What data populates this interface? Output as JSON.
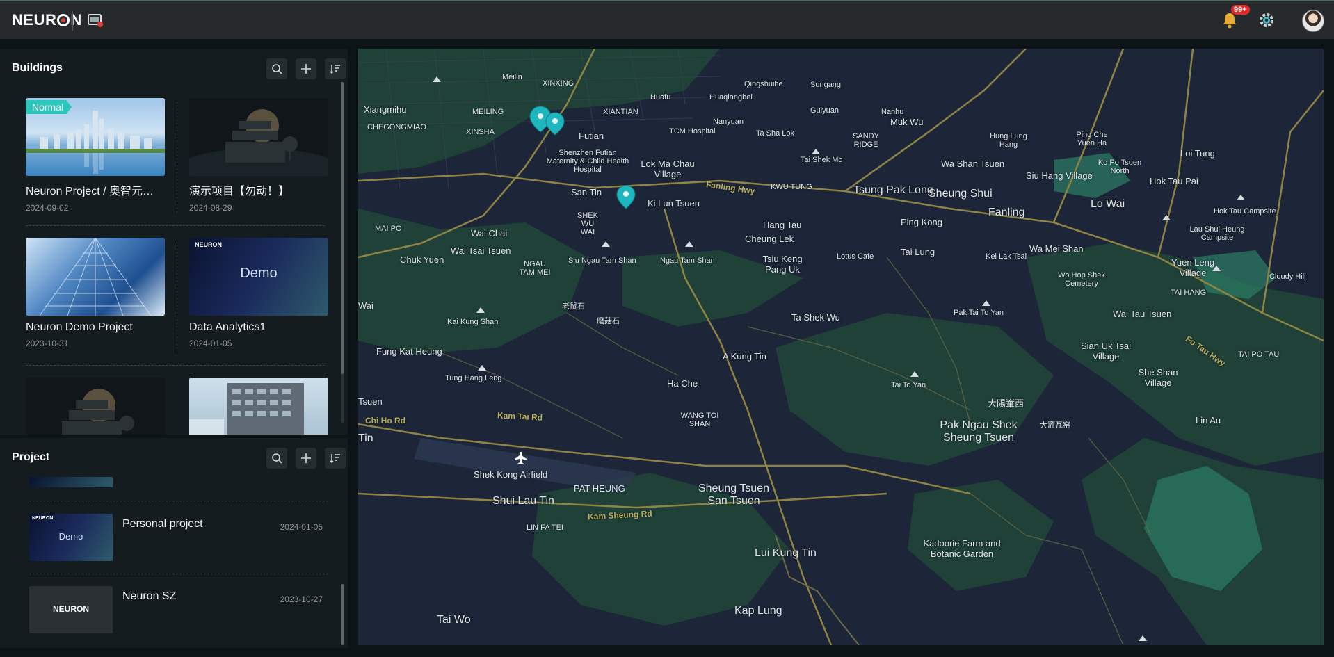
{
  "topbar": {
    "logo": "NEUR",
    "logo_end": "N",
    "notification_badge": "99+"
  },
  "buildings": {
    "title": "Buildings",
    "cards": [
      {
        "name": "Neuron Project / 奥智元…",
        "date": "2024-09-02",
        "tag": "Normal",
        "thumb": "city-skyline"
      },
      {
        "name": "演示项目【勿动！】",
        "date": "2024-08-29",
        "thumb": "placeholder-building"
      },
      {
        "name": "Neuron Demo Project",
        "date": "2023-10-31",
        "thumb": "glass-tower"
      },
      {
        "name": "Data Analytics1",
        "date": "2024-01-05",
        "thumb": "demo-banner",
        "demo_text": "Demo",
        "brand_text": "NEURON"
      },
      {
        "name": "",
        "date": "",
        "thumb": "placeholder-building"
      },
      {
        "name": "",
        "date": "",
        "thumb": "office-building"
      }
    ]
  },
  "project": {
    "title": "Project",
    "rows": [
      {
        "name": "Personal project",
        "date": "2024-01-05",
        "thumb": "demo-banner",
        "demo_text": "Demo",
        "brand_text": "NEURON"
      },
      {
        "name": "Neuron SZ",
        "date": "2023-10-27",
        "thumb": "neuron-logo",
        "brand_text": "NEURON"
      }
    ]
  },
  "map": {
    "labels": [
      {
        "text": "Xiangmihu",
        "type": "md"
      },
      {
        "text": "Meilin",
        "type": "sm"
      },
      {
        "text": "XINXING",
        "type": "sm"
      },
      {
        "text": "Futian",
        "type": "md"
      },
      {
        "text": "TCM Hospital",
        "type": "sm"
      },
      {
        "text": "Huafu",
        "type": "sm"
      },
      {
        "text": "Qingshuihe",
        "type": "sm"
      },
      {
        "text": "Sungang",
        "type": "sm"
      },
      {
        "text": "Guiyuan",
        "type": "sm"
      },
      {
        "text": "Nanhu",
        "type": "sm"
      },
      {
        "text": "Huaqiangbei",
        "type": "sm"
      },
      {
        "text": "Nanyuan",
        "type": "sm"
      },
      {
        "text": "Ta Sha Lok",
        "type": "sm"
      },
      {
        "text": "MEILING",
        "type": "sm"
      },
      {
        "text": "XINSHA",
        "type": "sm"
      },
      {
        "text": "XIANTIAN",
        "type": "sm"
      },
      {
        "text": "CHEGONGMIAO",
        "type": "sm"
      },
      {
        "text": "Shenzhen Futian Maternity & Child Health Hospital",
        "type": "sm"
      },
      {
        "text": "Lok Ma Chau Village",
        "type": "md"
      },
      {
        "text": "San Tin",
        "type": "md"
      },
      {
        "text": "Ki Lun Tsuen",
        "type": "md"
      },
      {
        "text": "Tai Shek Mo",
        "type": "sm"
      },
      {
        "text": "SANDY RIDGE",
        "type": "sm"
      },
      {
        "text": "Muk Wu",
        "type": "md"
      },
      {
        "text": "Hung Lung Hang",
        "type": "sm"
      },
      {
        "text": "Ping Che Yuen Ha",
        "type": "sm"
      },
      {
        "text": "Wa Shan Tsuen",
        "type": "md"
      },
      {
        "text": "Ko Po Tsuen North",
        "type": "sm"
      },
      {
        "text": "Loi Tung",
        "type": "md"
      },
      {
        "text": "Tsung Pak Long",
        "type": "lg"
      },
      {
        "text": "Sheung Shui",
        "type": "lg"
      },
      {
        "text": "Siu Hang Village",
        "type": "md"
      },
      {
        "text": "Hok Tau Pai",
        "type": "md"
      },
      {
        "text": "Fanling",
        "type": "lg"
      },
      {
        "text": "Lo Wai",
        "type": "lg"
      },
      {
        "text": "Hok Tau Campsite",
        "type": "sm"
      },
      {
        "text": "MAI PO",
        "type": "sm"
      },
      {
        "text": "Wai Chai",
        "type": "md"
      },
      {
        "text": "SHEK WU WAI",
        "type": "sm"
      },
      {
        "text": "Hang Tau",
        "type": "md"
      },
      {
        "text": "Ping Kong",
        "type": "md"
      },
      {
        "text": "Cheung Lek",
        "type": "md"
      },
      {
        "text": "Chuk Yuen",
        "type": "md"
      },
      {
        "text": "Wai Tsai Tsuen",
        "type": "md"
      },
      {
        "text": "Siu Ngau Tam Shan",
        "type": "sm"
      },
      {
        "text": "Ngau Tam Shan",
        "type": "sm"
      },
      {
        "text": "Tsiu Keng Pang Uk",
        "type": "md"
      },
      {
        "text": "Lotus Cafe",
        "type": "sm"
      },
      {
        "text": "Tai Lung",
        "type": "md"
      },
      {
        "text": "Kei Lak Tsai",
        "type": "sm"
      },
      {
        "text": "Wa Mei Shan",
        "type": "md"
      },
      {
        "text": "Wo Hop Shek Cemetery",
        "type": "sm"
      },
      {
        "text": "Yuen Leng Village",
        "type": "md"
      },
      {
        "text": "Cloudy Hill",
        "type": "sm"
      },
      {
        "text": "Lau Shui Heung Campsite",
        "type": "sm"
      },
      {
        "text": "NGAU TAM MEI",
        "type": "sm"
      },
      {
        "text": "老鼠石",
        "type": "sm"
      },
      {
        "text": "磨菇石",
        "type": "sm"
      },
      {
        "text": "Kai Kung Shan",
        "type": "sm"
      },
      {
        "text": "Ta Shek Wu",
        "type": "md"
      },
      {
        "text": "Pak Tai To Yan",
        "type": "sm"
      },
      {
        "text": "Wai Tau Tsuen",
        "type": "md"
      },
      {
        "text": "TAI HANG",
        "type": "sm"
      },
      {
        "text": "Fung Kat Heung",
        "type": "md"
      },
      {
        "text": "A Kung Tin",
        "type": "md"
      },
      {
        "text": "Tung Hang Leng",
        "type": "sm"
      },
      {
        "text": "Ha Che",
        "type": "md"
      },
      {
        "text": "Tai To Yan",
        "type": "sm"
      },
      {
        "text": "Sian Uk Tsai Village",
        "type": "md"
      },
      {
        "text": "She Shan Village",
        "type": "md"
      },
      {
        "text": "TAI PO TAU",
        "type": "sm"
      },
      {
        "text": "大陽輋西",
        "type": "md"
      },
      {
        "text": "WANG TOI SHAN",
        "type": "sm"
      },
      {
        "text": "Pak Ngau Shek Sheung Tsuen",
        "type": "lg"
      },
      {
        "text": "大竈瓦窑",
        "type": "sm"
      },
      {
        "text": "Lin Au",
        "type": "md"
      },
      {
        "text": "Shek Kong Airfield",
        "type": "md"
      },
      {
        "text": "PAT HEUNG",
        "type": "md"
      },
      {
        "text": "Shui Lau Tin",
        "type": "lg"
      },
      {
        "text": "Sheung Tsuen San Tsuen",
        "type": "lg"
      },
      {
        "text": "LIN FA TEI",
        "type": "sm"
      },
      {
        "text": "Kadoorie Farm and Botanic Garden",
        "type": "md"
      },
      {
        "text": "Lui Kung Tin",
        "type": "lg"
      },
      {
        "text": "Kap Lung",
        "type": "lg"
      },
      {
        "text": "Tai Wo",
        "type": "lg"
      },
      {
        "text": "Tsuen",
        "type": "md"
      },
      {
        "text": "Tin",
        "type": "lg"
      },
      {
        "text": "Wai",
        "type": "md"
      },
      {
        "text": "Kam Tai Rd",
        "type": "road"
      },
      {
        "text": "Kam Sheung Rd",
        "type": "road"
      },
      {
        "text": "Fanling Hwy",
        "type": "road"
      },
      {
        "text": "Chi Ho Rd",
        "type": "road"
      },
      {
        "text": "Fo Tau Hwy",
        "type": "road"
      },
      {
        "text": "KWU TUNG",
        "type": "sm"
      }
    ]
  }
}
